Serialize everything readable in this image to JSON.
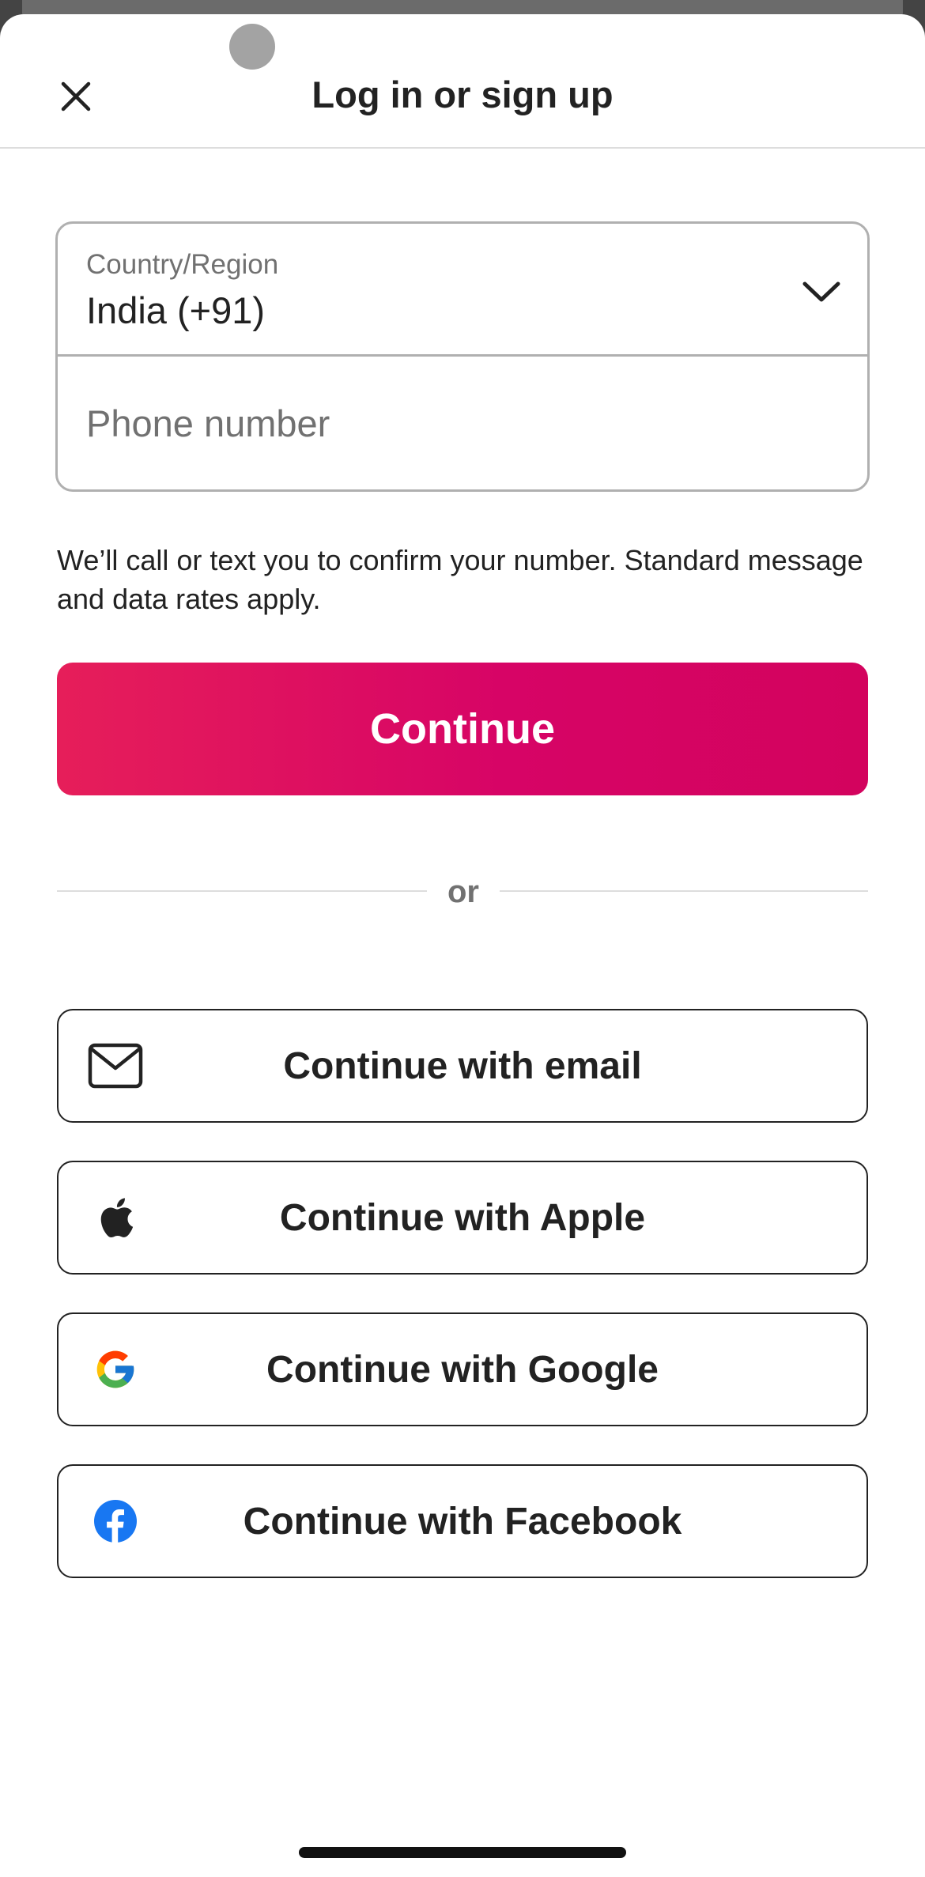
{
  "header": {
    "title": "Log in or sign up",
    "close_icon": "close-icon"
  },
  "country": {
    "label": "Country/Region",
    "value": "India (+91)",
    "chevron_icon": "chevron-down-icon"
  },
  "phone": {
    "placeholder": "Phone number",
    "value": ""
  },
  "note": "We’ll call or text you to confirm your number. Standard message and data rates apply.",
  "primary_button": {
    "label": "Continue",
    "color_start": "#e61e5a",
    "color_end": "#d70466"
  },
  "divider": {
    "label": "or"
  },
  "social_buttons": [
    {
      "id": "email",
      "icon": "mail-icon",
      "label": "Continue with email"
    },
    {
      "id": "apple",
      "icon": "apple-icon",
      "label": "Continue with Apple"
    },
    {
      "id": "google",
      "icon": "google-icon",
      "label": "Continue with Google"
    },
    {
      "id": "facebook",
      "icon": "facebook-icon",
      "label": "Continue with Facebook",
      "icon_color": "#1877f2"
    }
  ]
}
